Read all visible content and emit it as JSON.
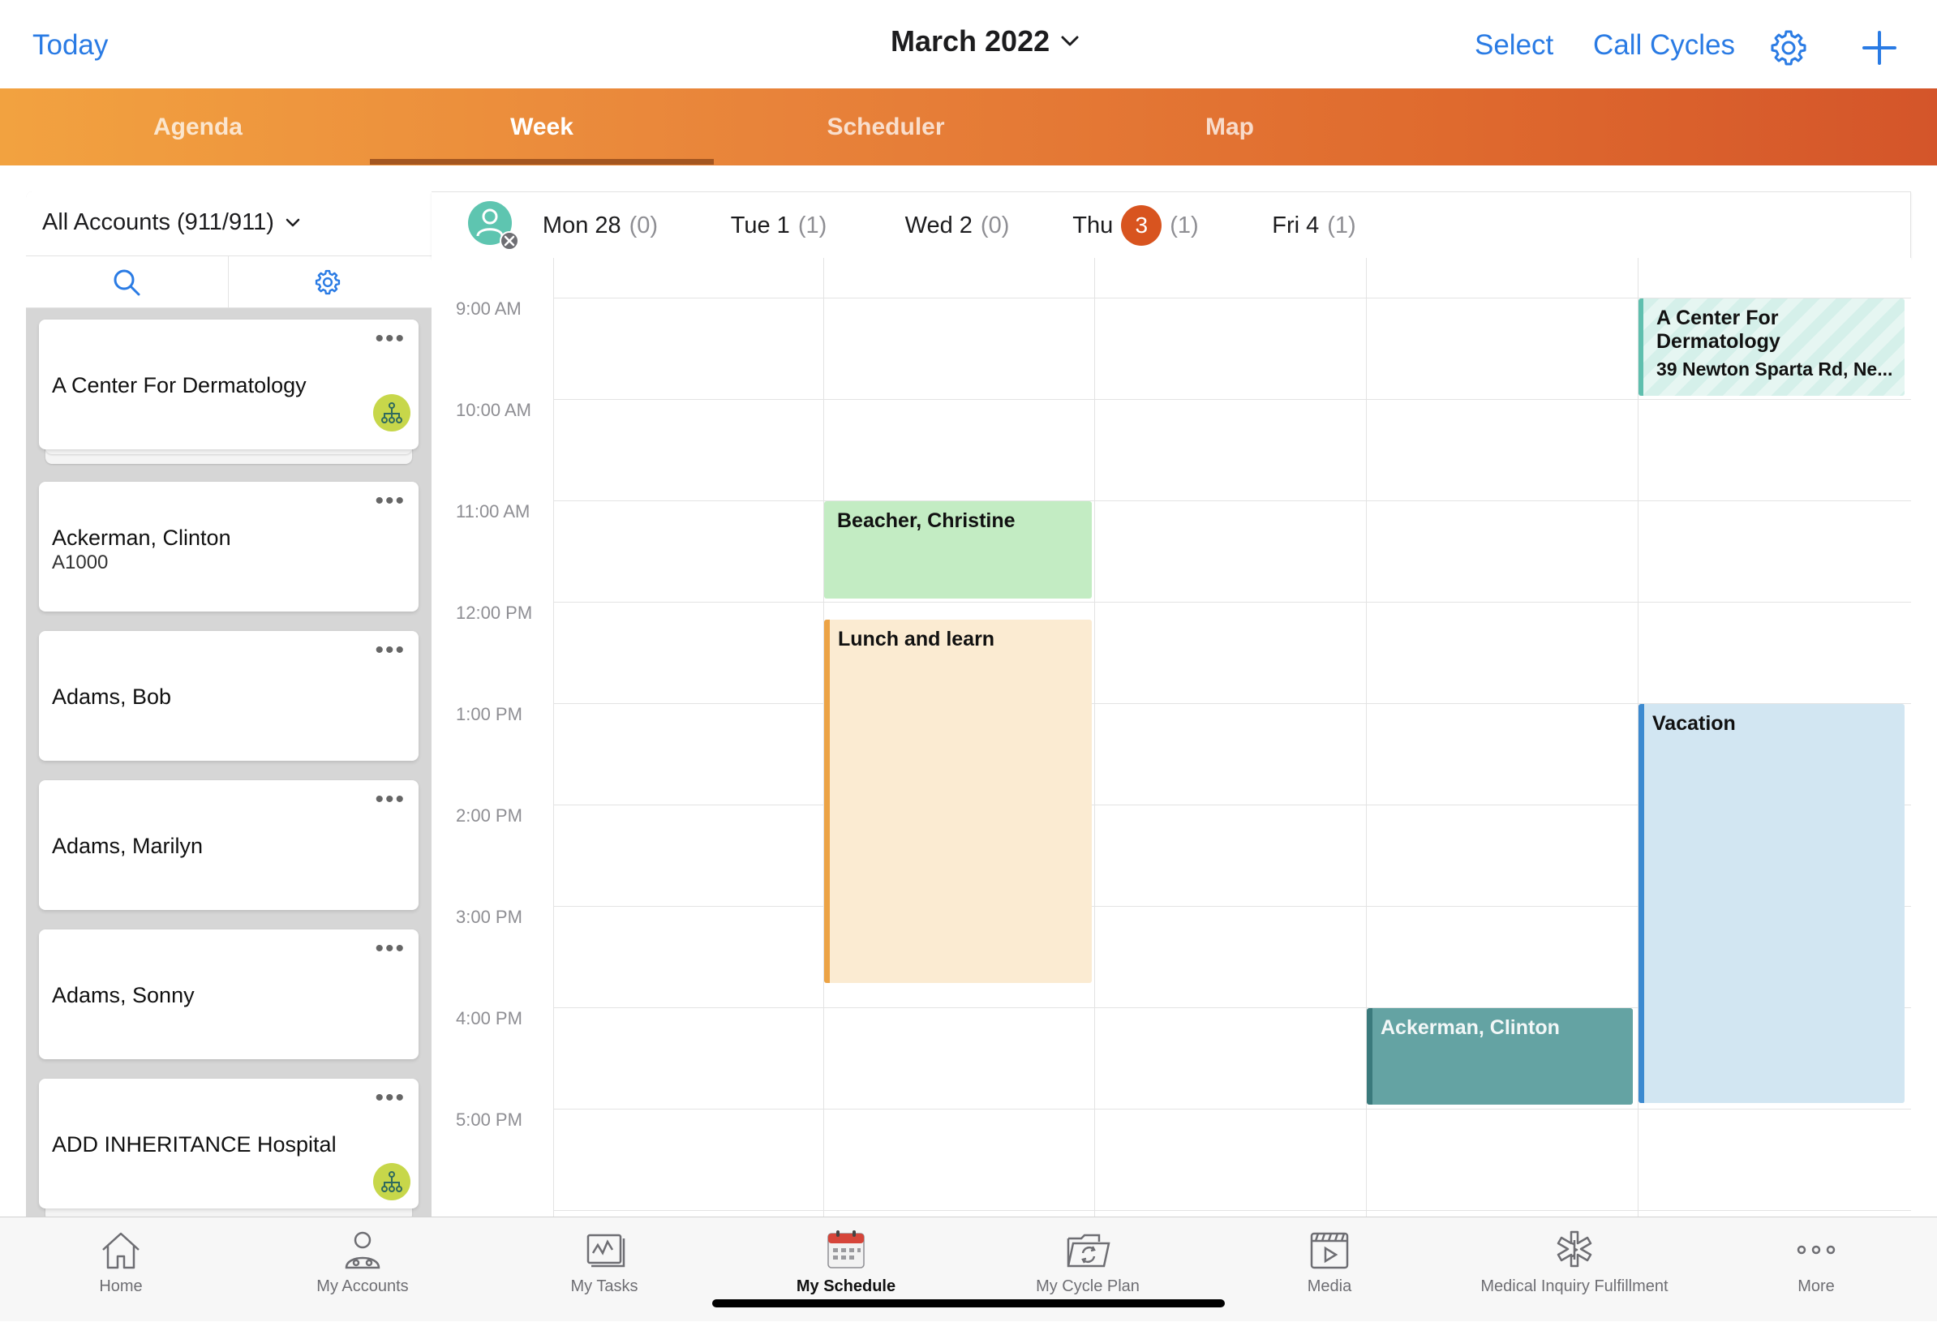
{
  "header": {
    "today_label": "Today",
    "title": "March 2022",
    "select_label": "Select",
    "call_cycles_label": "Call Cycles",
    "accent_color": "#2a7be4"
  },
  "tabs": [
    {
      "label": "Agenda",
      "active": false
    },
    {
      "label": "Week",
      "active": true
    },
    {
      "label": "Scheduler",
      "active": false
    },
    {
      "label": "Map",
      "active": false
    }
  ],
  "accounts_panel": {
    "filter_label": "All Accounts (911/911)",
    "cards": [
      {
        "name": "A Center For Dermatology",
        "sub": "",
        "org_badge": true
      },
      {
        "name": "Ackerman, Clinton",
        "sub": "A1000",
        "org_badge": false
      },
      {
        "name": "Adams, Bob",
        "sub": "",
        "org_badge": false
      },
      {
        "name": "Adams, Marilyn",
        "sub": "",
        "org_badge": false
      },
      {
        "name": "Adams, Sonny",
        "sub": "",
        "org_badge": false
      },
      {
        "name": "ADD INHERITANCE Hospital",
        "sub": "",
        "org_badge": true
      }
    ]
  },
  "calendar": {
    "days": [
      {
        "label": "Mon 28",
        "count": "(0)",
        "today": false
      },
      {
        "label": "Tue 1",
        "count": "(1)",
        "today": false
      },
      {
        "label": "Wed 2",
        "count": "(0)",
        "today": false
      },
      {
        "label": "Thu",
        "day_number": "3",
        "count": "(1)",
        "today": true
      },
      {
        "label": "Fri 4",
        "count": "(1)",
        "today": false
      }
    ],
    "times": [
      "9:00 AM",
      "10:00 AM",
      "11:00 AM",
      "12:00 PM",
      "1:00 PM",
      "2:00 PM",
      "3:00 PM",
      "4:00 PM",
      "5:00 PM"
    ],
    "events": [
      {
        "title": "A Center For Dermatology",
        "subtitle": "39 Newton Sparta Rd, Ne...",
        "day": "Fri 4",
        "start": "9:00 AM",
        "end": "10:00 AM",
        "color": "#d5f0ea"
      },
      {
        "title": "Beacher, Christine",
        "subtitle": "",
        "day": "Tue 1",
        "start": "11:00 AM",
        "end": "12:00 PM",
        "color": "#c3ecc3"
      },
      {
        "title": "Lunch and learn",
        "subtitle": "",
        "day": "Tue 1",
        "start": "12:10 PM",
        "end": "3:45 PM",
        "color": "#fbebd2"
      },
      {
        "title": "Vacation",
        "subtitle": "",
        "day": "Fri 4",
        "start": "1:00 PM",
        "end": "4:55 PM",
        "color": "#d2e6f2"
      },
      {
        "title": "Ackerman, Clinton",
        "subtitle": "",
        "day": "Thu 3",
        "start": "4:00 PM",
        "end": "5:00 PM",
        "color": "#64a3a3"
      }
    ]
  },
  "bottom_tabs": [
    {
      "label": "Home",
      "icon": "home-icon",
      "active": false
    },
    {
      "label": "My Accounts",
      "icon": "accounts-icon",
      "active": false
    },
    {
      "label": "My Tasks",
      "icon": "tasks-icon",
      "active": false
    },
    {
      "label": "My Schedule",
      "icon": "calendar-icon",
      "active": true
    },
    {
      "label": "My Cycle Plan",
      "icon": "cycle-plan-icon",
      "active": false
    },
    {
      "label": "Media",
      "icon": "media-icon",
      "active": false
    },
    {
      "label": "Medical Inquiry Fulfillment",
      "icon": "medical-icon",
      "active": false
    },
    {
      "label": "More",
      "icon": "more-icon",
      "active": false
    }
  ],
  "colors": {
    "today_badge": "#d8541f",
    "tab_band_start": "#f2a240",
    "tab_band_end": "#d4552a"
  }
}
